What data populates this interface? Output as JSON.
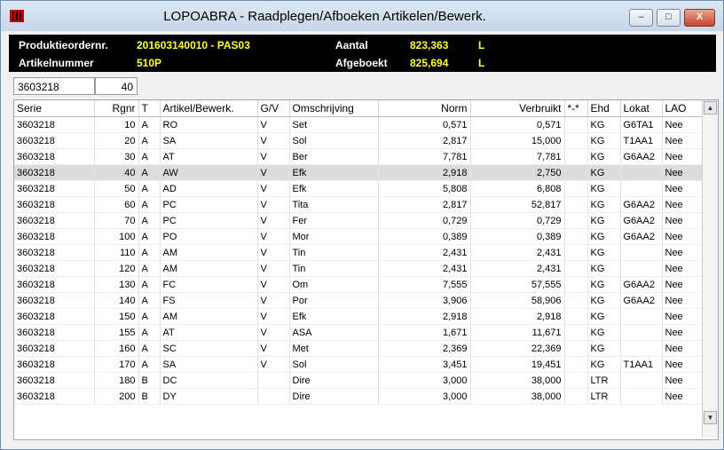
{
  "window": {
    "title": "LOPOABRA - Raadplegen/Afboeken Artikelen/Bewerk.",
    "minimize": "–",
    "maximize": "□",
    "close": "X"
  },
  "header": {
    "order_label": "Produktieordernr.",
    "order_value": "201603140010 - PAS03",
    "article_label": "Artikelnummer",
    "article_value": "510P",
    "amount_label": "Aantal",
    "amount_value": "823,363",
    "amount_unit": "L",
    "booked_label": "Afgeboekt",
    "booked_value": "825,694",
    "booked_unit": "L"
  },
  "filter": {
    "serie": "3603218",
    "rgnr": "40"
  },
  "table": {
    "columns": [
      "Serie",
      "Rgnr",
      "T",
      "Artikel/Bewerk.",
      "G/V",
      "Omschrijving",
      "Norm",
      "Verbruikt",
      "*-*",
      "Ehd",
      "Lokat",
      "LAO"
    ],
    "rows": [
      {
        "serie": "3603218",
        "rgnr": "10",
        "t": "A",
        "art": "RO",
        "gv": "V",
        "oms": "Set",
        "norm": "0,571",
        "verb": "0,571",
        "ehd": "KG",
        "lok": "G6TA1",
        "lao": "Nee"
      },
      {
        "serie": "3603218",
        "rgnr": "20",
        "t": "A",
        "art": "SA",
        "gv": "V",
        "oms": "Sol",
        "norm": "2,817",
        "verb": "15,000",
        "ehd": "KG",
        "lok": "T1AA1",
        "lao": "Nee"
      },
      {
        "serie": "3603218",
        "rgnr": "30",
        "t": "A",
        "art": "AT",
        "gv": "V",
        "oms": "Ber",
        "norm": "7,781",
        "verb": "7,781",
        "ehd": "KG",
        "lok": "G6AA2",
        "lao": "Nee"
      },
      {
        "serie": "3603218",
        "rgnr": "40",
        "t": "A",
        "art": "AW",
        "gv": "V",
        "oms": "Efk",
        "norm": "2,918",
        "verb": "2,750",
        "ehd": "KG",
        "lok": "",
        "lao": "Nee"
      },
      {
        "serie": "3603218",
        "rgnr": "50",
        "t": "A",
        "art": "AD",
        "gv": "V",
        "oms": "Efk",
        "norm": "5,808",
        "verb": "6,808",
        "ehd": "KG",
        "lok": "",
        "lao": "Nee"
      },
      {
        "serie": "3603218",
        "rgnr": "60",
        "t": "A",
        "art": "PC",
        "gv": "V",
        "oms": "Tita",
        "norm": "2,817",
        "verb": "52,817",
        "ehd": "KG",
        "lok": "G6AA2",
        "lao": "Nee"
      },
      {
        "serie": "3603218",
        "rgnr": "70",
        "t": "A",
        "art": "PC",
        "gv": "V",
        "oms": "Fer",
        "norm": "0,729",
        "verb": "0,729",
        "ehd": "KG",
        "lok": "G6AA2",
        "lao": "Nee"
      },
      {
        "serie": "3603218",
        "rgnr": "100",
        "t": "A",
        "art": "PO",
        "gv": "V",
        "oms": "Mor",
        "norm": "0,389",
        "verb": "0,389",
        "ehd": "KG",
        "lok": "G6AA2",
        "lao": "Nee"
      },
      {
        "serie": "3603218",
        "rgnr": "110",
        "t": "A",
        "art": "AM",
        "gv": "V",
        "oms": "Tin",
        "norm": "2,431",
        "verb": "2,431",
        "ehd": "KG",
        "lok": "",
        "lao": "Nee"
      },
      {
        "serie": "3603218",
        "rgnr": "120",
        "t": "A",
        "art": "AM",
        "gv": "V",
        "oms": "Tin",
        "norm": "2,431",
        "verb": "2,431",
        "ehd": "KG",
        "lok": "",
        "lao": "Nee"
      },
      {
        "serie": "3603218",
        "rgnr": "130",
        "t": "A",
        "art": "FC",
        "gv": "V",
        "oms": "Om",
        "norm": "7,555",
        "verb": "57,555",
        "ehd": "KG",
        "lok": "G6AA2",
        "lao": "Nee"
      },
      {
        "serie": "3603218",
        "rgnr": "140",
        "t": "A",
        "art": "FS",
        "gv": "V",
        "oms": "Por",
        "norm": "3,906",
        "verb": "58,906",
        "ehd": "KG",
        "lok": "G6AA2",
        "lao": "Nee"
      },
      {
        "serie": "3603218",
        "rgnr": "150",
        "t": "A",
        "art": "AM",
        "gv": "V",
        "oms": "Efk",
        "norm": "2,918",
        "verb": "2,918",
        "ehd": "KG",
        "lok": "",
        "lao": "Nee"
      },
      {
        "serie": "3603218",
        "rgnr": "155",
        "t": "A",
        "art": "AT",
        "gv": "V",
        "oms": "ASA",
        "norm": "1,671",
        "verb": "11,671",
        "ehd": "KG",
        "lok": "",
        "lao": "Nee"
      },
      {
        "serie": "3603218",
        "rgnr": "160",
        "t": "A",
        "art": "SC",
        "gv": "V",
        "oms": "Met",
        "norm": "2,369",
        "verb": "22,369",
        "ehd": "KG",
        "lok": "",
        "lao": "Nee"
      },
      {
        "serie": "3603218",
        "rgnr": "170",
        "t": "A",
        "art": "SA",
        "gv": "V",
        "oms": "Sol",
        "norm": "3,451",
        "verb": "19,451",
        "ehd": "KG",
        "lok": "T1AA1",
        "lao": "Nee"
      },
      {
        "serie": "3603218",
        "rgnr": "180",
        "t": "B",
        "art": "DC",
        "gv": "",
        "oms": "Dire",
        "norm": "3,000",
        "verb": "38,000",
        "ehd": "LTR",
        "lok": "",
        "lao": "Nee"
      },
      {
        "serie": "3603218",
        "rgnr": "200",
        "t": "B",
        "art": "DY",
        "gv": "",
        "oms": "Dire",
        "norm": "3,000",
        "verb": "38,000",
        "ehd": "LTR",
        "lok": "",
        "lao": "Nee"
      }
    ],
    "selected_index": 3
  },
  "scrollbar": {
    "up": "▲",
    "down": "▼"
  },
  "colors": {
    "header_bg": "#000000",
    "header_value": "#ffff33",
    "selected_row": "#dcdcdc"
  }
}
